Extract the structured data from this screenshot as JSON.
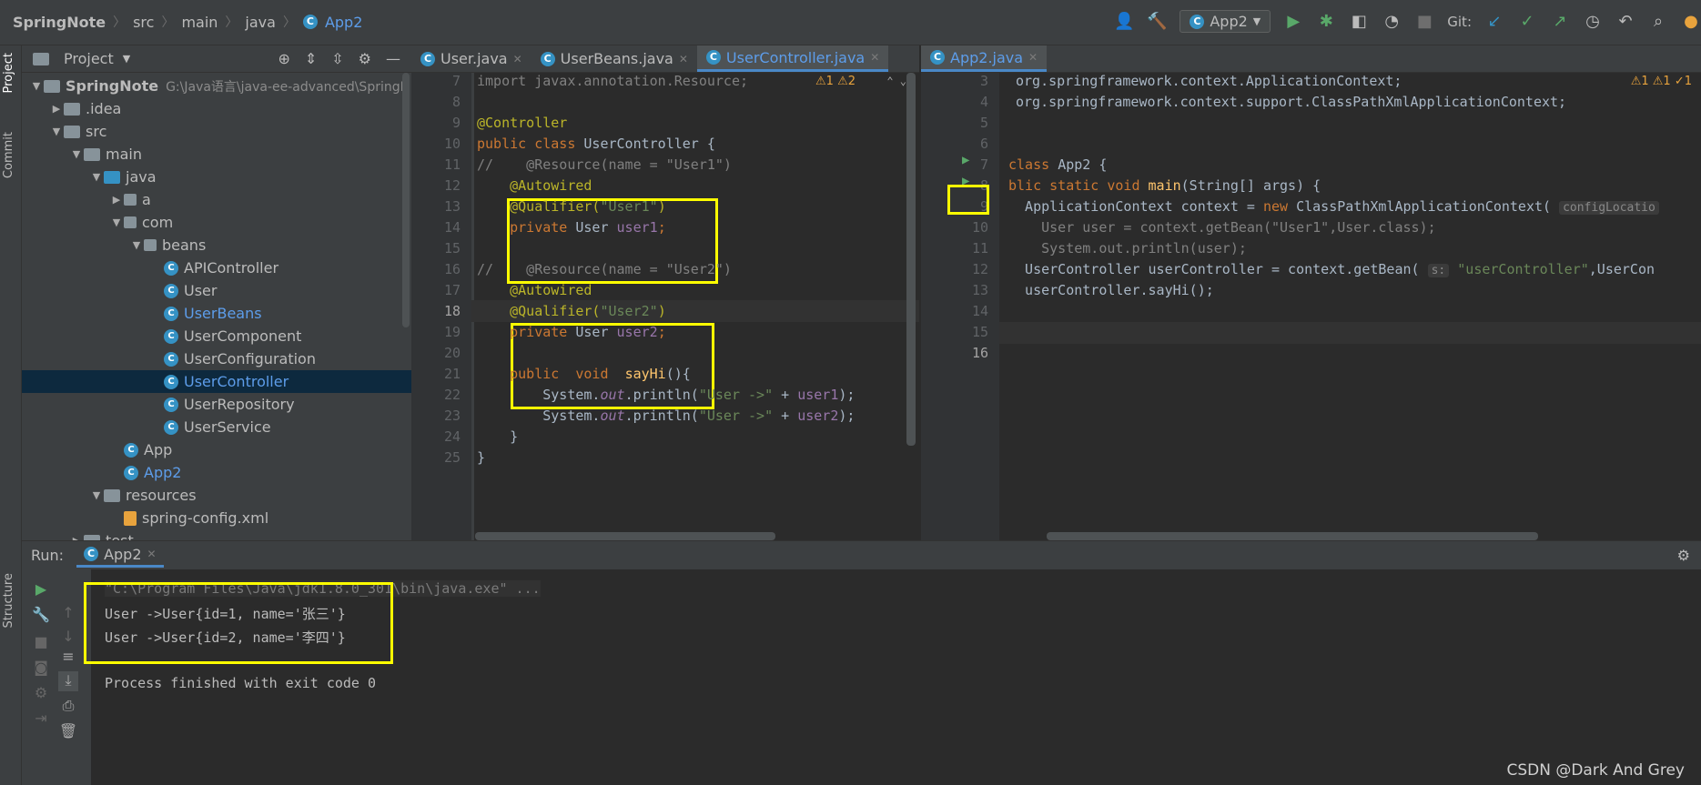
{
  "breadcrumb": {
    "items": [
      "SpringNote",
      "src",
      "main",
      "java"
    ],
    "current": "App2"
  },
  "toolbar": {
    "run_config": "App2",
    "git_label": "Git:"
  },
  "left_strip": {
    "project": "Project",
    "commit": "Commit",
    "structure": "Structure"
  },
  "project_panel": {
    "title": "Project"
  },
  "tree": [
    {
      "label": "SpringNote",
      "extra": "G:\\Java语言\\java-ee-advanced\\SpringN",
      "depth": 0,
      "icon": "folder",
      "open": true,
      "bold": true
    },
    {
      "label": ".idea",
      "depth": 1,
      "icon": "folder",
      "open": false
    },
    {
      "label": "src",
      "depth": 1,
      "icon": "folder",
      "open": true
    },
    {
      "label": "main",
      "depth": 2,
      "icon": "folder",
      "open": true
    },
    {
      "label": "java",
      "depth": 3,
      "icon": "folder-blue",
      "open": true
    },
    {
      "label": "a",
      "depth": 4,
      "icon": "package",
      "open": false
    },
    {
      "label": "com",
      "depth": 4,
      "icon": "package",
      "open": true
    },
    {
      "label": "beans",
      "depth": 5,
      "icon": "package",
      "open": true
    },
    {
      "label": "APIController",
      "depth": 6,
      "icon": "class"
    },
    {
      "label": "User",
      "depth": 6,
      "icon": "class"
    },
    {
      "label": "UserBeans",
      "depth": 6,
      "icon": "class",
      "blue": true
    },
    {
      "label": "UserComponent",
      "depth": 6,
      "icon": "class"
    },
    {
      "label": "UserConfiguration",
      "depth": 6,
      "icon": "class"
    },
    {
      "label": "UserController",
      "depth": 6,
      "icon": "class",
      "selected": true,
      "blue": true
    },
    {
      "label": "UserRepository",
      "depth": 6,
      "icon": "class"
    },
    {
      "label": "UserService",
      "depth": 6,
      "icon": "class"
    },
    {
      "label": "App",
      "depth": 4,
      "icon": "class"
    },
    {
      "label": "App2",
      "depth": 4,
      "icon": "class",
      "blue": true
    },
    {
      "label": "resources",
      "depth": 3,
      "icon": "folder",
      "open": true
    },
    {
      "label": "spring-config.xml",
      "depth": 4,
      "icon": "xml"
    },
    {
      "label": "test",
      "depth": 2,
      "icon": "folder",
      "open": false
    }
  ],
  "tabs_left": [
    {
      "label": "User.java",
      "active": false
    },
    {
      "label": "UserBeans.java",
      "active": false
    },
    {
      "label": "UserController.java",
      "active": true
    }
  ],
  "tabs_right": [
    {
      "label": "App2.java",
      "active": true
    }
  ],
  "editor1": {
    "inspection": "⚠1 ⚠2",
    "line_numbers": [
      "7",
      "8",
      "9",
      "10",
      "11",
      "12",
      "13",
      "14",
      "15",
      "16",
      "17",
      "18",
      "19",
      "20",
      "21",
      "22",
      "23",
      "24",
      "25"
    ],
    "lines": [
      [
        [
          "cmt",
          "import javax.annotation.Resource;"
        ]
      ],
      [],
      [
        [
          "ann",
          "@Controller"
        ]
      ],
      [
        [
          "kw",
          "public class "
        ],
        [
          "",
          "UserController {"
        ]
      ],
      [
        [
          "cmt",
          "//    @Resource(name = \"User1\")"
        ]
      ],
      [
        [
          "",
          "    "
        ],
        [
          "ann",
          "@Autowired"
        ]
      ],
      [
        [
          "",
          "    "
        ],
        [
          "ann",
          "@Qualifier("
        ],
        [
          "str",
          "\"User1\""
        ],
        [
          "ann",
          ")"
        ]
      ],
      [
        [
          "",
          "    "
        ],
        [
          "kw",
          "private "
        ],
        [
          "",
          "User "
        ],
        [
          "fld",
          "user1"
        ],
        [
          "kw",
          ";"
        ]
      ],
      [],
      [
        [
          "cmt",
          "//    @Resource(name = \"User2\")"
        ]
      ],
      [
        [
          "",
          "    "
        ],
        [
          "ann",
          "@Autowired"
        ]
      ],
      [
        [
          "",
          "    "
        ],
        [
          "ann",
          "@Qualifier("
        ],
        [
          "str",
          "\"User2\""
        ],
        [
          "ann",
          ")"
        ]
      ],
      [
        [
          "",
          "    "
        ],
        [
          "kw",
          "private "
        ],
        [
          "",
          "User "
        ],
        [
          "fld",
          "user2"
        ],
        [
          "kw",
          ";"
        ]
      ],
      [],
      [
        [
          "",
          "    "
        ],
        [
          "kw",
          "public  void  "
        ],
        [
          "fn",
          "sayHi"
        ],
        [
          "",
          "(){"
        ]
      ],
      [
        [
          "",
          "        System."
        ],
        [
          "it",
          "out"
        ],
        [
          "",
          ".println("
        ],
        [
          "str",
          "\"User ->\""
        ],
        [
          "",
          " + "
        ],
        [
          "fld",
          "user1"
        ],
        [
          "",
          "); "
        ]
      ],
      [
        [
          "",
          "        System."
        ],
        [
          "it",
          "out"
        ],
        [
          "",
          ".println("
        ],
        [
          "str",
          "\"User ->\""
        ],
        [
          "",
          " + "
        ],
        [
          "fld",
          "user2"
        ],
        [
          "",
          "); "
        ]
      ],
      [
        [
          "",
          "    }"
        ]
      ],
      [
        [
          "",
          "}"
        ]
      ]
    ]
  },
  "editor2": {
    "inspection": "⚠1 ⚠1 ✓1",
    "line_numbers": [
      "3",
      "4",
      "5",
      "6",
      "7",
      "8",
      "9",
      "10",
      "11",
      "12",
      "13",
      "14",
      "15",
      "16"
    ],
    "lines": [
      [
        [
          "",
          "org.springframework.context.ApplicationContext;"
        ]
      ],
      [
        [
          "",
          "org.springframework.context.support.ClassPathXmlApplicationContext;"
        ]
      ],
      [],
      [],
      [
        [
          "kw",
          "class "
        ],
        [
          "",
          "App2 {"
        ]
      ],
      [
        [
          "kw",
          "blic static void "
        ],
        [
          "fn",
          "main"
        ],
        [
          "",
          "(String[] args) {"
        ]
      ],
      [
        [
          "",
          "  ApplicationContext context = "
        ],
        [
          "kw",
          "new "
        ],
        [
          "",
          "ClassPathXmlApplicationContext( "
        ],
        [
          "hint",
          "configLocatio"
        ]
      ],
      [
        [
          "",
          "    "
        ],
        [
          "cmt",
          "User user = context.getBean(\"User1\",User.class);"
        ]
      ],
      [
        [
          "",
          "    "
        ],
        [
          "cmt",
          "System.out.println(user);"
        ]
      ],
      [
        [
          "",
          "  UserController userController = context.getBean( "
        ],
        [
          "hint",
          "s:"
        ],
        [
          "str",
          " \"userController\""
        ],
        [
          "",
          ",UserCon"
        ]
      ],
      [
        [
          "",
          "  userController.sayHi();"
        ]
      ],
      [],
      [],
      []
    ]
  },
  "run": {
    "label": "Run:",
    "tab": "App2",
    "console": [
      "\"C:\\Program Files\\Java\\jdk1.8.0_301\\bin\\java.exe\" ...",
      "User ->User{id=1, name='张三'}",
      "User ->User{id=2, name='李四'}",
      "",
      "Process finished with exit code 0"
    ]
  },
  "watermark": "CSDN @Dark And Grey",
  "colors": {
    "highlight_box": "#ffff00",
    "accent": "#4a88c7",
    "selected_row": "#0d293e"
  }
}
